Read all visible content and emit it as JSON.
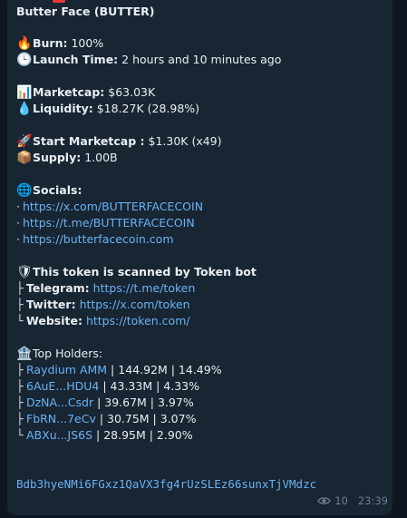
{
  "title": "Butter Face (BUTTER)",
  "burn": {
    "icon": "fire-icon",
    "label": "Burn:",
    "value": " 100%"
  },
  "launch": {
    "icon": "clock-icon",
    "label": "Launch Time:",
    "value": " 2 hours and 10 minutes ago"
  },
  "marketcap": {
    "icon": "chart-icon",
    "label": "Marketcap:",
    "value": " $63.03K"
  },
  "liquidity": {
    "icon": "droplet-icon",
    "label": "Liquidity:",
    "value": " $18.27K (28.98%)"
  },
  "start_mc": {
    "icon": "rocket-icon",
    "label": "Start Marketcap :",
    "value": " $1.30K (x49)"
  },
  "supply": {
    "icon": "package-icon",
    "label": "Supply:",
    "value": " 1.00B"
  },
  "socials": {
    "icon": "globe-icon",
    "label": "Socials:",
    "links": [
      "https://x.com/BUTTERFACECOIN",
      "https://t.me/BUTTERFACECOIN",
      "https://butterfacecoin.com"
    ]
  },
  "scanned": {
    "icon": "shield-icon",
    "label": "This token is scanned by Token bot",
    "items": [
      {
        "prefix": "├",
        "label": "Telegram:",
        "link": "https://t.me/token"
      },
      {
        "prefix": "├",
        "label": "Twitter:",
        "link": "https://x.com/token"
      },
      {
        "prefix": "└",
        "label": "Website:",
        "link": "https://token.com/"
      }
    ]
  },
  "holders": {
    "icon": "bank-icon",
    "label": "Top Holders:",
    "rows": [
      {
        "prefix": "├",
        "name": "Raydium AMM",
        "amount": " | 144.92M | 14.49%"
      },
      {
        "prefix": "├",
        "name": "6AuE...HDU4",
        "amount": " | 43.33M | 4.33%"
      },
      {
        "prefix": "├",
        "name": "DzNA...Csdr",
        "amount": " | 39.67M | 3.97%"
      },
      {
        "prefix": "├",
        "name": "FbRN...7eCv",
        "amount": " | 30.75M | 3.07%"
      },
      {
        "prefix": "└",
        "name": "ABXu...JS6S",
        "amount": " | 28.95M | 2.90%"
      }
    ]
  },
  "contract": "Bdb3hyeNMi6FGxz1QaVX3fg4rUzSLEz66sunxTjVMdzc",
  "views": "10",
  "time": "23:39",
  "colors": {
    "link": "#6ab3f3",
    "bubble": "#182533",
    "background": "#0e1621",
    "meta": "#6d7f8f"
  }
}
